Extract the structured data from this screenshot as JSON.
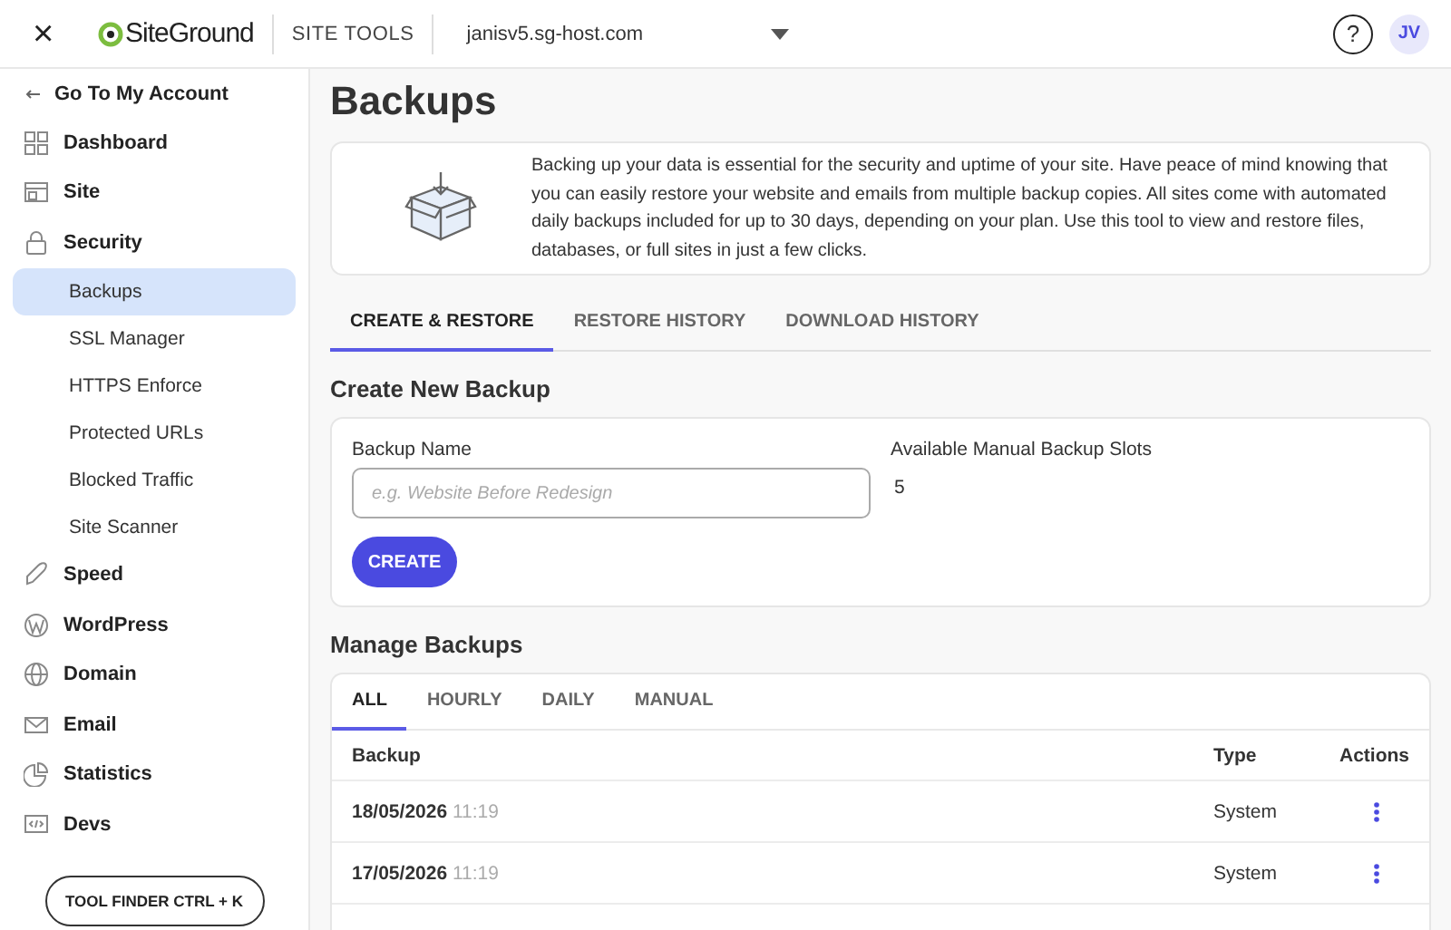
{
  "header": {
    "close": "×",
    "logo": "SiteGround",
    "section": "SITE TOOLS",
    "domain": "janisv5.sg-host.com",
    "help": "?",
    "avatar": "JV"
  },
  "sidebar": {
    "back": "Go To My Account",
    "items": [
      {
        "label": "Dashboard",
        "selected": false
      },
      {
        "label": "Site",
        "selected": false
      },
      {
        "label": "Security",
        "selected": false,
        "children": [
          {
            "label": "Backups",
            "selected": true
          },
          {
            "label": "SSL Manager",
            "selected": false
          },
          {
            "label": "HTTPS Enforce",
            "selected": false
          },
          {
            "label": "Protected URLs",
            "selected": false
          },
          {
            "label": "Blocked Traffic",
            "selected": false
          },
          {
            "label": "Site Scanner",
            "selected": false
          }
        ]
      },
      {
        "label": "Speed",
        "selected": false
      },
      {
        "label": "WordPress",
        "selected": false
      },
      {
        "label": "Domain",
        "selected": false
      },
      {
        "label": "Email",
        "selected": false
      },
      {
        "label": "Statistics",
        "selected": false
      },
      {
        "label": "Devs",
        "selected": false
      }
    ],
    "tool_finder": "TOOL FINDER CTRL + K"
  },
  "page": {
    "title": "Backups",
    "intro": "Backing up your data is essential for the security and uptime of your site. Have peace of mind knowing that you can easily restore your website and emails from multiple backup copies. All sites come with automated daily backups included for up to 30 days, depending on your plan. Use this tool to view and restore files, databases, or full sites in just a few clicks.",
    "tabs": [
      {
        "label": "CREATE & RESTORE",
        "selected": true
      },
      {
        "label": "RESTORE HISTORY",
        "selected": false
      },
      {
        "label": "DOWNLOAD HISTORY",
        "selected": false
      }
    ],
    "create": {
      "heading": "Create New Backup",
      "name_label": "Backup Name",
      "placeholder": "e.g. Website Before Redesign",
      "slots_label": "Available Manual Backup Slots",
      "slots": "5",
      "button": "CREATE"
    },
    "manage": {
      "heading": "Manage Backups",
      "filters": [
        {
          "label": "ALL",
          "selected": true
        },
        {
          "label": "HOURLY",
          "selected": false
        },
        {
          "label": "DAILY",
          "selected": false
        },
        {
          "label": "MANUAL",
          "selected": false
        }
      ],
      "columns": [
        "Backup",
        "Type",
        "Actions"
      ],
      "rows": [
        {
          "date": "18/05/2026",
          "time": "11:19",
          "type": "System"
        },
        {
          "date": "17/05/2026",
          "time": "11:19",
          "type": "System"
        }
      ]
    }
  }
}
